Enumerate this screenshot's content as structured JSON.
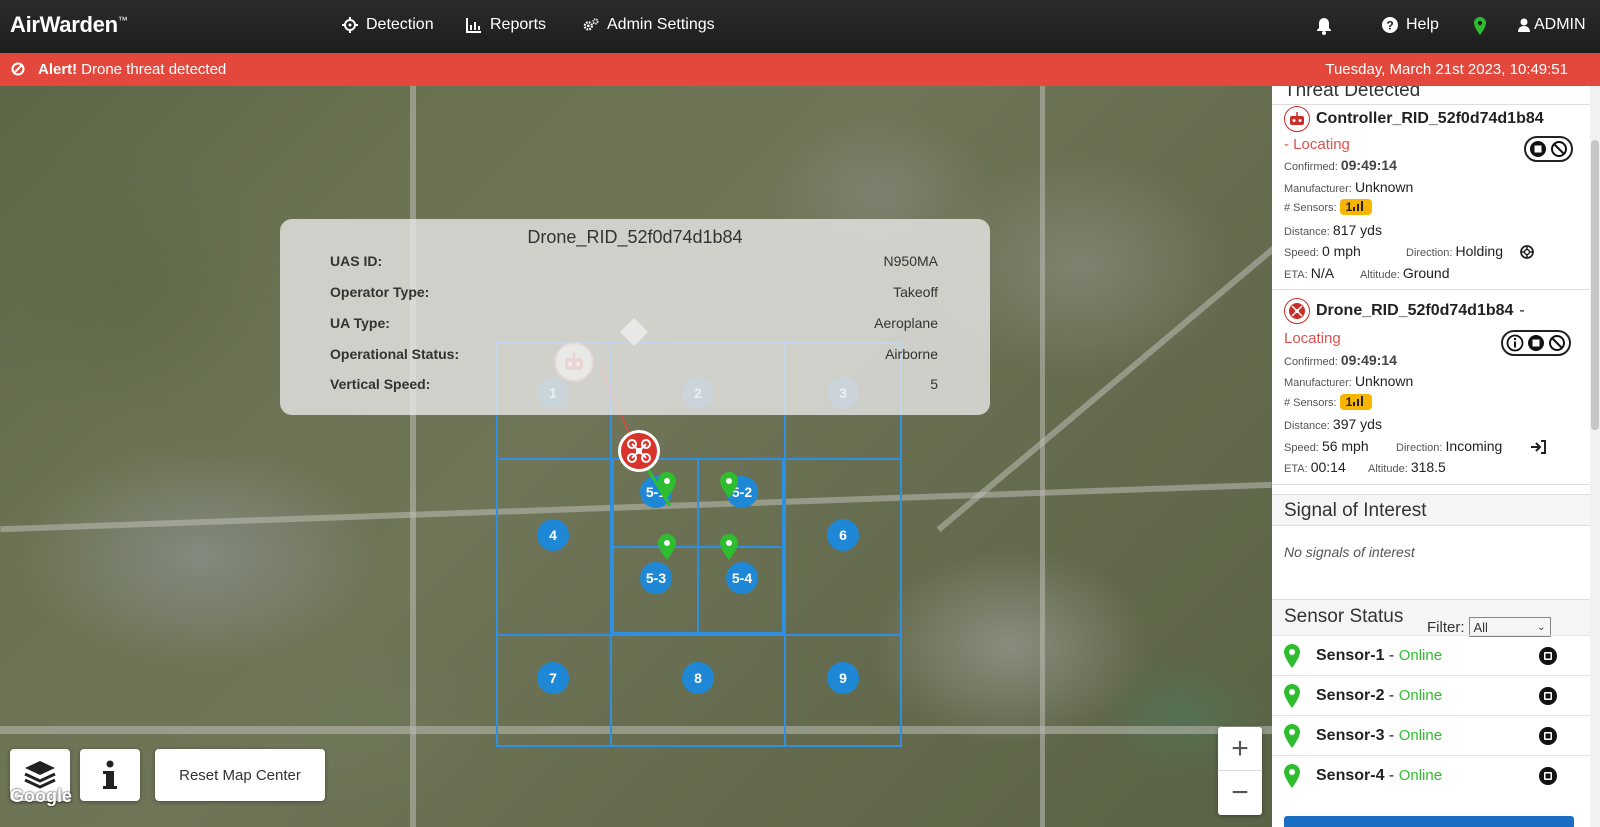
{
  "app": {
    "brand": "AirWarden",
    "trademark": "™"
  },
  "nav": {
    "detection": "Detection",
    "reports": "Reports",
    "admin_settings": "Admin Settings",
    "help": "Help",
    "user": "ADMIN"
  },
  "alert": {
    "label": "Alert!",
    "message": "Drone threat detected",
    "datetime": "Tuesday, March 21st 2023, 10:49:51",
    "color": "#e4483c"
  },
  "popup": {
    "title": "Drone_RID_52f0d74d1b84",
    "rows": [
      {
        "key": "UAS ID:",
        "value": "N950MA"
      },
      {
        "key": "Operator Type:",
        "value": "Takeoff"
      },
      {
        "key": "UA Type:",
        "value": "Aeroplane"
      },
      {
        "key": "Operational Status:",
        "value": "Airborne"
      },
      {
        "key": "Vertical Speed:",
        "value": "5"
      }
    ]
  },
  "zones": [
    "1",
    "2",
    "3",
    "4",
    "5-1",
    "5-2",
    "5-3",
    "5-4",
    "6",
    "7",
    "8",
    "9"
  ],
  "map": {
    "reset_label": "Reset Map Center",
    "zoom_in": "+",
    "zoom_out": "−",
    "attribution": "Google"
  },
  "panel": {
    "threat_heading": "Threat Detected",
    "threats": [
      {
        "name": "Controller_RID_52f0d74d1b84",
        "status_prefix": "- ",
        "status": "Locating",
        "confirmed_label": "Confirmed:",
        "confirmed": "09:49:14",
        "manufacturer_label": "Manufacturer:",
        "manufacturer": "Unknown",
        "sensors_label": "# Sensors:",
        "distance_label": "Distance:",
        "distance": "817 yds",
        "speed_label": "Speed:",
        "speed": "0 mph",
        "direction_label": "Direction:",
        "direction": "Holding",
        "eta_label": "ETA:",
        "eta": "N/A",
        "altitude_label": "Altitude:",
        "altitude": "Ground"
      },
      {
        "name": "Drone_RID_52f0d74d1b84",
        "status_prefix": " -",
        "status": "Locating",
        "confirmed_label": "Confirmed:",
        "confirmed": "09:49:14",
        "manufacturer_label": "Manufacturer:",
        "manufacturer": "Unknown",
        "sensors_label": "# Sensors:",
        "distance_label": "Distance:",
        "distance": "397 yds",
        "speed_label": "Speed:",
        "speed": "56 mph",
        "direction_label": "Direction:",
        "direction": "Incoming",
        "eta_label": "ETA:",
        "eta": "00:14",
        "altitude_label": "Altitude:",
        "altitude": "318.5"
      }
    ],
    "signal_heading": "Signal of Interest",
    "no_signals": "No signals of interest",
    "sensor_heading": "Sensor Status",
    "filter_label": "Filter:",
    "filter_value": "All",
    "sensors": [
      {
        "name": "Sensor-1",
        "status": "Online"
      },
      {
        "name": "Sensor-2",
        "status": "Online"
      },
      {
        "name": "Sensor-3",
        "status": "Online"
      },
      {
        "name": "Sensor-4",
        "status": "Online"
      }
    ]
  },
  "colors": {
    "online": "#2ebd2e",
    "locating": "#d9534f",
    "zone": "#1e88d6",
    "badge": "#f7b500"
  }
}
